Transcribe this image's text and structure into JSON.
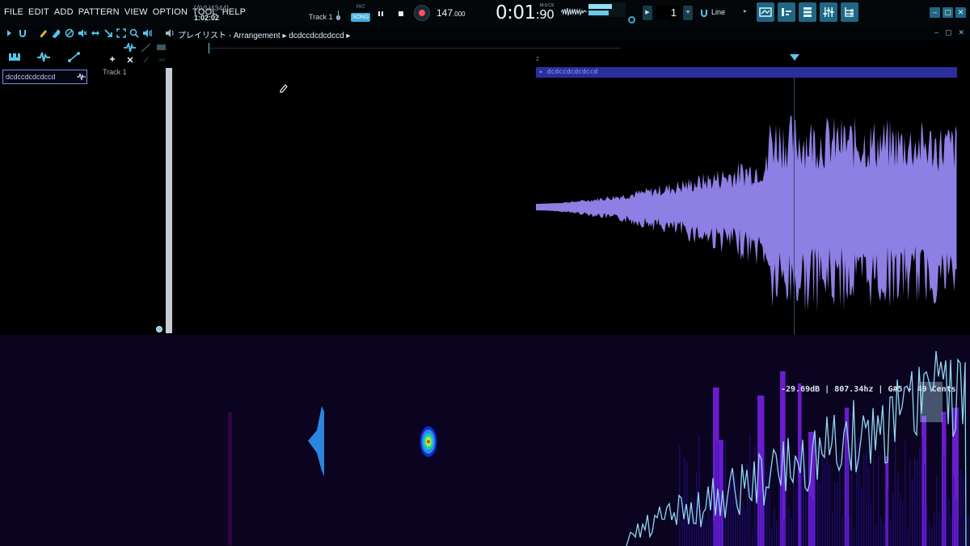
{
  "menu": [
    "FILE",
    "EDIT",
    "ADD",
    "PATTERN",
    "VIEW",
    "OPTION",
    "TOOL",
    "HELP"
  ],
  "hint": {
    "code": "[AVU4344]",
    "time": "1:02:02"
  },
  "transport": {
    "track_label": "Track 1",
    "pat_label": "PAT",
    "song_label": "SONG",
    "tempo": "147",
    "tempo_decimal": ".000",
    "clock_main": "0:01",
    "clock_sub": ":90",
    "clock_unit": "M:S:CS",
    "pattern_number": "1",
    "snap_label": "Line",
    "output_level": 0.62
  },
  "playlist": {
    "title": "プレイリスト - Arrangement ▸ dcdccdcdcdccd ▸",
    "bar_number": "2",
    "track_name": "Track 1",
    "clip_name": "dcdccdcdcdccd",
    "picker_item": "dcdccdcdcdccd"
  },
  "analyzer": {
    "readout": "-29.69dB | 807.34hz | G#5 - 49 Cents"
  },
  "colors": {
    "accent": "#3fb0d8",
    "waveform": "#8d7fe3",
    "clip_header": "#2b2f9e",
    "analyzer_bg": "#0a0420",
    "spectrum_line": "#8fd6ef",
    "spectrum_bars": "#6a1ccd"
  },
  "icons": [
    "magnet-icon",
    "pencil-icon",
    "paint-icon",
    "delete-icon",
    "mute-icon",
    "slip-icon",
    "slice-icon",
    "select-icon",
    "zoom-icon",
    "speaker-icon"
  ]
}
